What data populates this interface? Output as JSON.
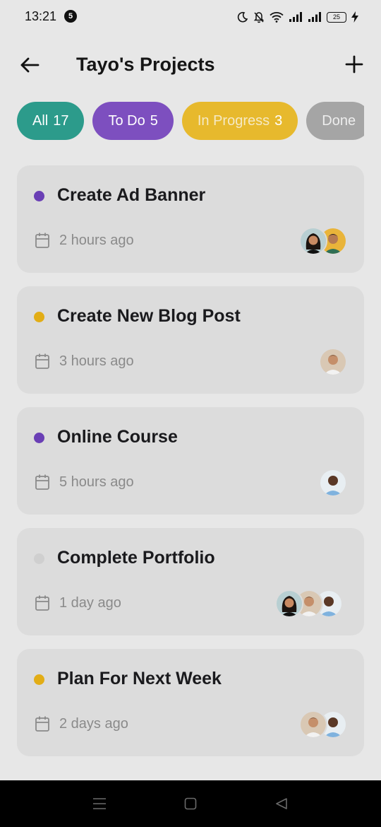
{
  "status_bar": {
    "time": "13:21",
    "notification_count": "5",
    "battery_level": "25"
  },
  "header": {
    "title": "Tayo's Projects"
  },
  "filters": [
    {
      "label": "All",
      "count": "17",
      "color": "#2c9b8b"
    },
    {
      "label": "To Do",
      "count": "5",
      "color": "#7d4fbf"
    },
    {
      "label": "In Progress",
      "count": "3",
      "color": "#e7b92d"
    },
    {
      "label": "Done",
      "count": "",
      "color": "#a5a5a5"
    }
  ],
  "tasks": [
    {
      "title": "Create Ad Banner",
      "time": "2 hours ago",
      "status_color": "#6a3fb5",
      "avatars": [
        "person-woman-avatar",
        "person-man-yellow-avatar"
      ]
    },
    {
      "title": "Create New Blog Post",
      "time": "3 hours ago",
      "status_color": "#e2ad16",
      "avatars": [
        "person-man-beige-avatar"
      ]
    },
    {
      "title": "Online Course",
      "time": "5 hours ago",
      "status_color": "#6a3fb5",
      "avatars": [
        "person-man-blue-avatar"
      ]
    },
    {
      "title": "Complete Portfolio",
      "time": "1 day ago",
      "status_color": "#cfcfcf",
      "avatars": [
        "person-woman-avatar",
        "person-man-beige-avatar",
        "person-man-blue-avatar"
      ]
    },
    {
      "title": "Plan For Next Week",
      "time": "2 days ago",
      "status_color": "#e2ad16",
      "avatars": [
        "person-man-beige-avatar",
        "person-man-blue-avatar"
      ]
    }
  ]
}
